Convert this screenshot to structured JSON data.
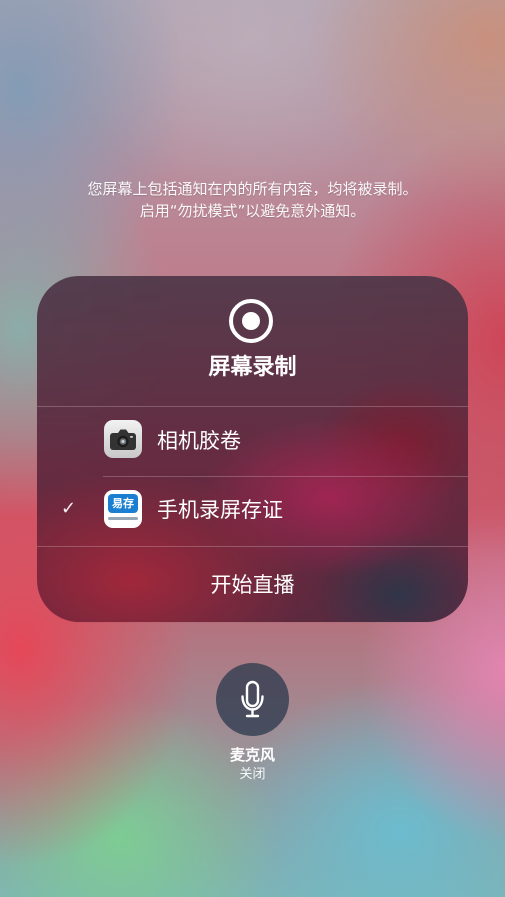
{
  "notice": {
    "line1": "您屏幕上包括通知在内的所有内容，均将被录制。",
    "line2": "启用“勿扰模式”以避免意外通知。"
  },
  "panel": {
    "title": "屏幕录制",
    "apps": [
      {
        "label": "相机胶卷",
        "icon": "camera-icon",
        "selected": false
      },
      {
        "label": "手机录屏存证",
        "icon": "yicun-app-icon",
        "logo_text": "易存",
        "selected": true
      }
    ],
    "start_broadcast": "开始直播"
  },
  "microphone": {
    "title": "麦克风",
    "status": "关闭",
    "icon": "microphone-icon"
  },
  "colors": {
    "panel": "#5a2d45",
    "text": "#ffffff",
    "mic_button": "#2b3a4e",
    "yicun_blue": "#1b7fd1"
  }
}
